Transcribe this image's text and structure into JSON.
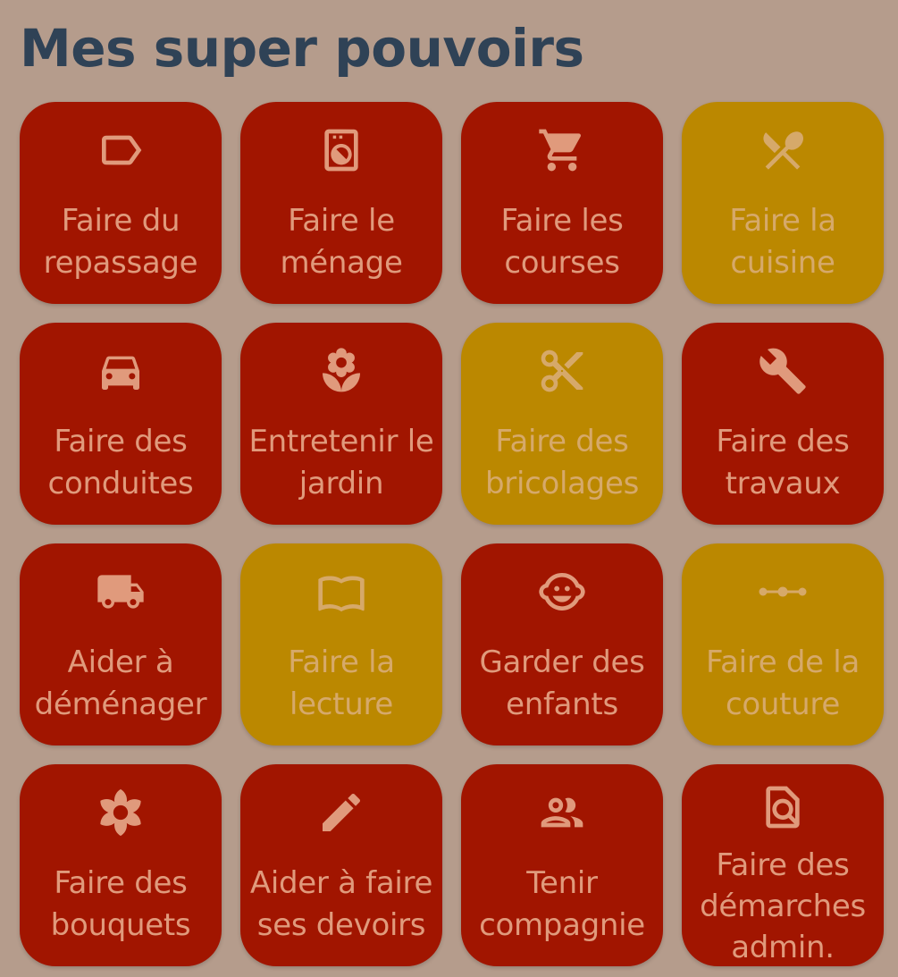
{
  "page": {
    "title": "Mes super pouvoirs"
  },
  "colors": {
    "background": "#b59c8c",
    "title": "#2f4256",
    "tile_red": "#a11500",
    "tile_amber": "#bb8800",
    "text_on_red": "#e09a7c",
    "text_on_amber": "#d6a96a"
  },
  "tiles": [
    {
      "label": "Faire du\nrepassage",
      "icon": "tag-icon",
      "state": "red"
    },
    {
      "label": "Faire le\nménage",
      "icon": "washing-machine-icon",
      "state": "red"
    },
    {
      "label": "Faire les\ncourses",
      "icon": "shopping-cart-icon",
      "state": "red"
    },
    {
      "label": "Faire la\ncuisine",
      "icon": "fork-spoon-icon",
      "state": "amber"
    },
    {
      "label": "Faire des\nconduites",
      "icon": "car-icon",
      "state": "red"
    },
    {
      "label": "Entretenir le\njardin",
      "icon": "flower-pot-icon",
      "state": "red"
    },
    {
      "label": "Faire des\nbricolages",
      "icon": "scissors-icon",
      "state": "amber"
    },
    {
      "label": "Faire des\ntravaux",
      "icon": "wrench-icon",
      "state": "red"
    },
    {
      "label": "Aider à\ndéménager",
      "icon": "truck-icon",
      "state": "red"
    },
    {
      "label": "Faire la\nlecture",
      "icon": "book-icon",
      "state": "amber"
    },
    {
      "label": "Garder des\nenfants",
      "icon": "child-face-icon",
      "state": "red"
    },
    {
      "label": "Faire de la\ncouture",
      "icon": "stitch-icon",
      "state": "amber"
    },
    {
      "label": "Faire des\nbouquets",
      "icon": "flower-icon",
      "state": "red"
    },
    {
      "label": "Aider à faire\nses devoirs",
      "icon": "pencil-icon",
      "state": "red"
    },
    {
      "label": "Tenir\ncompagnie",
      "icon": "people-icon",
      "state": "red"
    },
    {
      "label": "Faire des\ndémarches\nadmin.",
      "icon": "document-search-icon",
      "state": "red"
    }
  ]
}
